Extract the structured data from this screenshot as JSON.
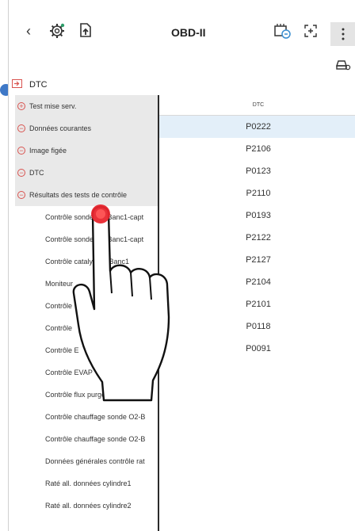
{
  "header": {
    "title": "OBD-II",
    "back_icon": "chevron-left-icon",
    "icons": [
      "settings-gear-icon",
      "file-upload-icon",
      "ecu-diagnostic-icon",
      "scan-icon",
      "more-vertical-icon",
      "car-key-icon"
    ]
  },
  "dtc_header": {
    "label": "DTC"
  },
  "tree": {
    "items": [
      {
        "label": "Test mise serv.",
        "icon": "+"
      },
      {
        "label": "Données courantes",
        "icon": "−"
      },
      {
        "label": "Image figée",
        "icon": "−"
      },
      {
        "label": "DTC",
        "icon": "−"
      },
      {
        "label": "Résultats des tests de contrôle",
        "icon": "−"
      }
    ],
    "children": [
      "Contrôle sonde O2-Banc1-capt",
      "Contrôle sonde O2-Banc1-capt",
      "Contrôle catalyseur-Banc1",
      "Moniteur",
      "Contrôle",
      "Contrôle",
      "Contrôle E",
      "Contrôle EVAP",
      "Contrôle flux purge",
      "Contrôle chauffage sonde O2-B",
      "Contrôle chauffage sonde O2-B",
      "Données générales contrôle rat",
      "Raté all. données cylindre1",
      "Raté all. données cylindre2"
    ]
  },
  "table": {
    "header": "DTC",
    "rows": [
      "P0222",
      "P2106",
      "P0123",
      "P2110",
      "P0193",
      "P2122",
      "P2127",
      "P2104",
      "P2101",
      "P0118",
      "P0091"
    ],
    "selected_index": 0
  },
  "colors": {
    "accent_red": "#d9534f",
    "selection_blue": "#e3eff9",
    "dot_blue": "#3e78c7"
  }
}
